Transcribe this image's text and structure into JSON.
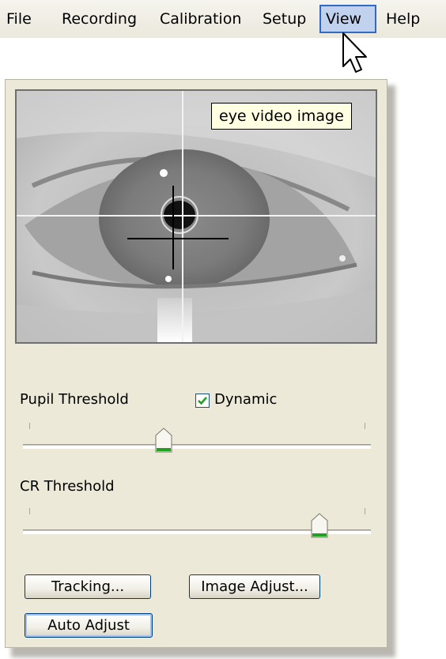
{
  "menubar": {
    "items": [
      "File",
      "Recording",
      "Calibration",
      "Setup",
      "View",
      "Help"
    ],
    "active_item": "View"
  },
  "panel": {
    "tooltip": "eye video image",
    "pupil_threshold": {
      "label": "Pupil Threshold",
      "dynamic_label": "Dynamic",
      "dynamic_checked": true,
      "value_fraction": 0.4
    },
    "cr_threshold": {
      "label": "CR Threshold",
      "value_fraction": 0.87
    },
    "buttons": {
      "tracking": "Tracking...",
      "image_adjust": "Image Adjust...",
      "auto_adjust": "Auto Adjust"
    }
  },
  "colors": {
    "menu_highlight": "#c1d2ee",
    "panel_bg": "#ece9d8",
    "tooltip_bg": "#ffffe1",
    "slider_thumb_accent": "#21a121",
    "checkmark": "#21a121"
  },
  "icons": {
    "cursor": "arrow-cursor-icon",
    "checkbox": "checkmark-icon",
    "slider_thumb": "slider-thumb-icon"
  }
}
